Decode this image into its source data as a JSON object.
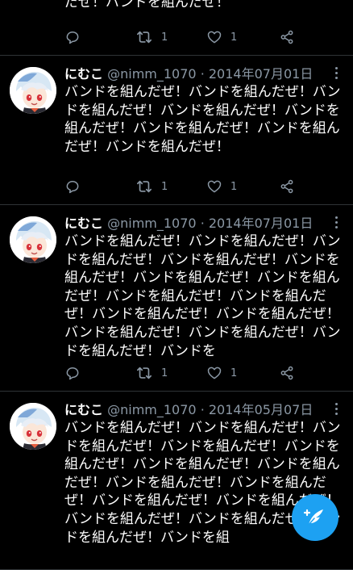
{
  "partial_tweet": {
    "text": "だぜ！バンドを組んだぜ！",
    "reply_count": "",
    "retweet_count": "1",
    "like_count": "1"
  },
  "tweets": [
    {
      "name": "にむこ",
      "handle": "@nimm_1070",
      "separator": "·",
      "date": "2014年07月01日",
      "text": "バンドを組んだぜ！バンドを組んだぜ！バンドを組んだぜ！バンドを組んだぜ！バンドを組んだぜ！バンドを組んだぜ！バンドを組んだぜ！バンドを組んだぜ！",
      "reply_count": "",
      "retweet_count": "1",
      "like_count": "1"
    },
    {
      "name": "にむこ",
      "handle": "@nimm_1070",
      "separator": "·",
      "date": "2014年07月01日",
      "text": "バンドを組んだぜ！バンドを組んだぜ！バンドを組んだぜ！バンドを組んだぜ！バンドを組んだぜ！バンドを組んだぜ！バンドを組んだぜ！バンドを組んだぜ！バンドを組んだぜ！バンドを組んだぜ！バンドを組んだぜ！バンドを組んだぜ！バンドを組んだぜ！バンドを組んだぜ！バンドを",
      "reply_count": "",
      "retweet_count": "1",
      "like_count": "1"
    },
    {
      "name": "にむこ",
      "handle": "@nimm_1070",
      "separator": "·",
      "date": "2014年05月07日",
      "text": "バンドを組んだぜ！バンドを組んだぜ！バンドを組んだぜ！バンドを組んだぜ！バンドを組んだぜ！バンドを組んだぜ！バンドを組んだぜ！バンドを組んだぜ！バンドを組んだぜ！バンドを組んだぜ！バンドを組んだぜ！バンドを組んだぜ！バンドを組んだぜ！バンドを組んだぜ！バンドを組",
      "reply_count": "",
      "retweet_count": "1",
      "like_count": "1"
    }
  ],
  "colors": {
    "background": "#000000",
    "secondary_text": "#8b98a5",
    "divider": "#2f3336",
    "accent": "#1da1f2"
  },
  "icons": [
    "reply-icon",
    "retweet-icon",
    "like-icon",
    "share-icon",
    "more-icon",
    "compose-icon"
  ]
}
